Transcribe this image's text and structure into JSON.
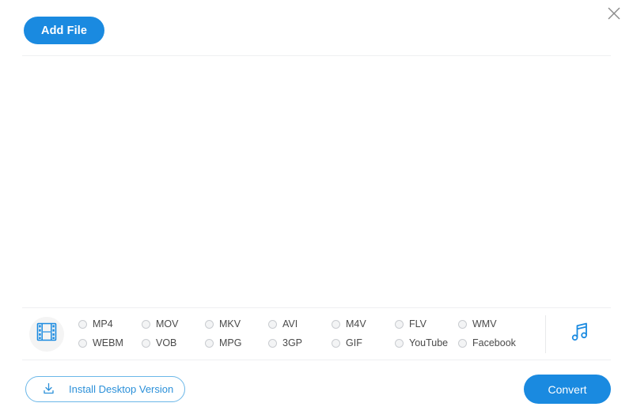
{
  "window": {
    "close_icon": "close-icon"
  },
  "toolbar": {
    "add_file_label": "Add File"
  },
  "formats": {
    "video_icon": "film-strip-icon",
    "audio_icon": "music-note-icon",
    "options": [
      {
        "label": "MP4",
        "selected": false
      },
      {
        "label": "MOV",
        "selected": false
      },
      {
        "label": "MKV",
        "selected": false
      },
      {
        "label": "AVI",
        "selected": false
      },
      {
        "label": "M4V",
        "selected": false
      },
      {
        "label": "FLV",
        "selected": false
      },
      {
        "label": "WMV",
        "selected": false
      },
      {
        "label": "WEBM",
        "selected": false
      },
      {
        "label": "VOB",
        "selected": false
      },
      {
        "label": "MPG",
        "selected": false
      },
      {
        "label": "3GP",
        "selected": false
      },
      {
        "label": "GIF",
        "selected": false
      },
      {
        "label": "YouTube",
        "selected": false
      },
      {
        "label": "Facebook",
        "selected": false
      }
    ]
  },
  "footer": {
    "install_label": "Install Desktop Version",
    "install_icon": "download-icon",
    "convert_label": "Convert"
  },
  "colors": {
    "accent_blue": "#1a8ae0",
    "outline_blue": "#6bb7e8",
    "divider": "#eeeff1",
    "radio_border": "#c9ccd0"
  }
}
